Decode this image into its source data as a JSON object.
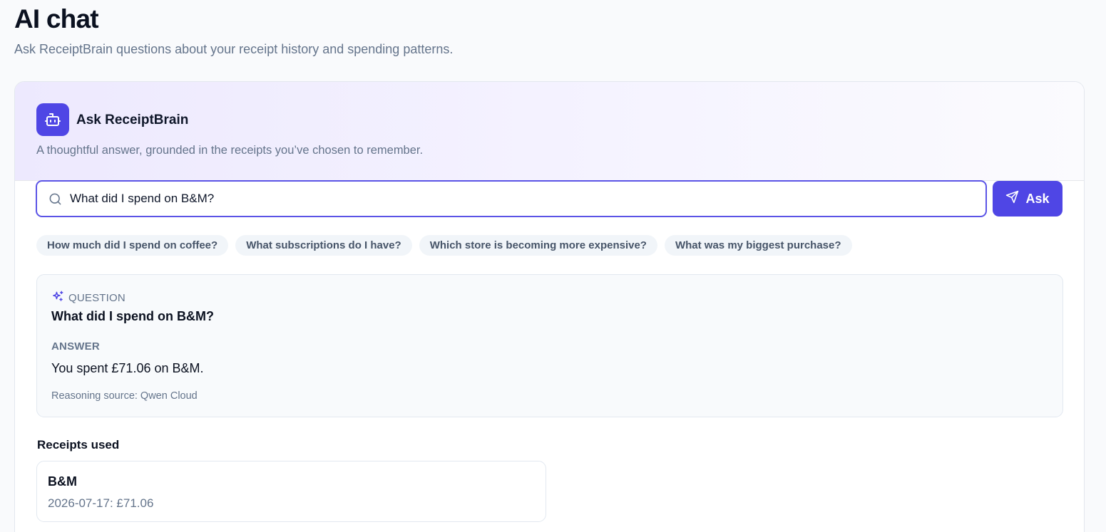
{
  "page": {
    "title": "AI chat",
    "subtitle": "Ask ReceiptBrain questions about your receipt history and spending patterns."
  },
  "assistant": {
    "title": "Ask ReceiptBrain",
    "tagline": "A thoughtful answer, grounded in the receipts you’ve chosen to remember.",
    "icon": "robot-icon"
  },
  "search": {
    "value": "What did I spend on B&M?",
    "icon": "search-icon",
    "ask_label": "Ask",
    "ask_icon": "send-icon"
  },
  "suggestions": [
    "How much did I spend on coffee?",
    "What subscriptions do I have?",
    "Which store is becoming more expensive?",
    "What was my biggest purchase?"
  ],
  "result": {
    "question_label": "Question",
    "question": "What did I spend on B&M?",
    "answer_label": "Answer",
    "answer": "You spent £71.06 on B&M.",
    "source": "Reasoning source: Qwen Cloud"
  },
  "receipts": {
    "heading": "Receipts used",
    "items": [
      {
        "store": "B&M",
        "detail": "2026-07-17: £71.06"
      }
    ]
  },
  "colors": {
    "accent": "#4f46e5",
    "muted_text": "#64748b",
    "chip_bg": "#f1f5f9"
  }
}
